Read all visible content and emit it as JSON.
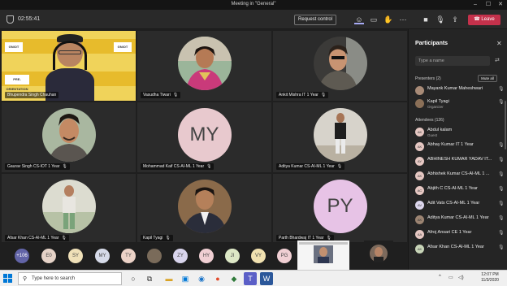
{
  "window": {
    "title": "Meeting in \"General\""
  },
  "toolbar": {
    "timer": "02:55:41",
    "request_control": "Request control",
    "leave": "Leave"
  },
  "tiles": [
    {
      "name": "Bhupendra Singh Chauhan",
      "kind": "presenter"
    },
    {
      "name": "Vasudha Tiwari",
      "kind": "photo"
    },
    {
      "name": "Ankit Mishra IT 1 Year",
      "kind": "photo"
    },
    {
      "name": "Gaurav Singh CS-IOT 1 Year",
      "kind": "photo"
    },
    {
      "name": "Mohammad Kaif CS-AI-ML 1 Year",
      "kind": "initials",
      "initials": "MY"
    },
    {
      "name": "Aditya Kumar CS-AI-ML 1 Year",
      "kind": "photo"
    },
    {
      "name": "Afsar Khan CS-AI-ML 1 Year",
      "kind": "photo"
    },
    {
      "name": "Kapil Tyagi",
      "kind": "photo"
    },
    {
      "name": "Parth Bhardwaj IT 1 Year",
      "kind": "initials",
      "initials": "PY"
    }
  ],
  "presenter_banner": {
    "logo_left": "GNIOT",
    "logo_right": "GNIOT",
    "badge": "PRE-ORIENTATION"
  },
  "strip": {
    "more_count": "+106",
    "chips": [
      "E0",
      "SY",
      "MY",
      "TY",
      "",
      "ZY",
      "HY",
      "JI",
      "VY",
      "PG"
    ],
    "shared_label": "Shared Screen"
  },
  "participants": {
    "title": "Participants",
    "search_placeholder": "Type a name",
    "presenters_label": "Presenters (2)",
    "mute_all": "Mute all",
    "presenters": [
      {
        "name": "Mayank Kumar Maheshwari",
        "sub": ""
      },
      {
        "name": "Kapil Tyagi",
        "sub": "Organizer"
      }
    ],
    "attendees_label": "Attendees (126)",
    "attendees": [
      {
        "name": "Abdul kalam",
        "sub": "Guest",
        "initials": "AK"
      },
      {
        "name": "Abhay Kumar IT 1 Year",
        "sub": "",
        "initials": "AK"
      },
      {
        "name": "ABHINESH KUMAR YADAV IT...",
        "sub": "",
        "initials": "AY"
      },
      {
        "name": "Abhishek Kumar CS-AI-ML 1 ...",
        "sub": "",
        "initials": "AK"
      },
      {
        "name": "Abjith C CS-AI-ML 1 Year",
        "sub": "",
        "initials": "AC"
      },
      {
        "name": "Adit Vats CS-AI-ML 1 Year",
        "sub": "",
        "initials": "AV"
      },
      {
        "name": "Aditya Kumar CS-AI-ML 1 Year",
        "sub": "",
        "initials": "AK"
      },
      {
        "name": "Afroj Ansari CE 1 Year",
        "sub": "",
        "initials": "AA"
      },
      {
        "name": "Afsar Khan CS-AI-ML 1 Year",
        "sub": "",
        "initials": "AK"
      }
    ]
  },
  "taskbar": {
    "search_placeholder": "Type here to search",
    "time": "12:07 PM",
    "date": "11/3/2020"
  }
}
